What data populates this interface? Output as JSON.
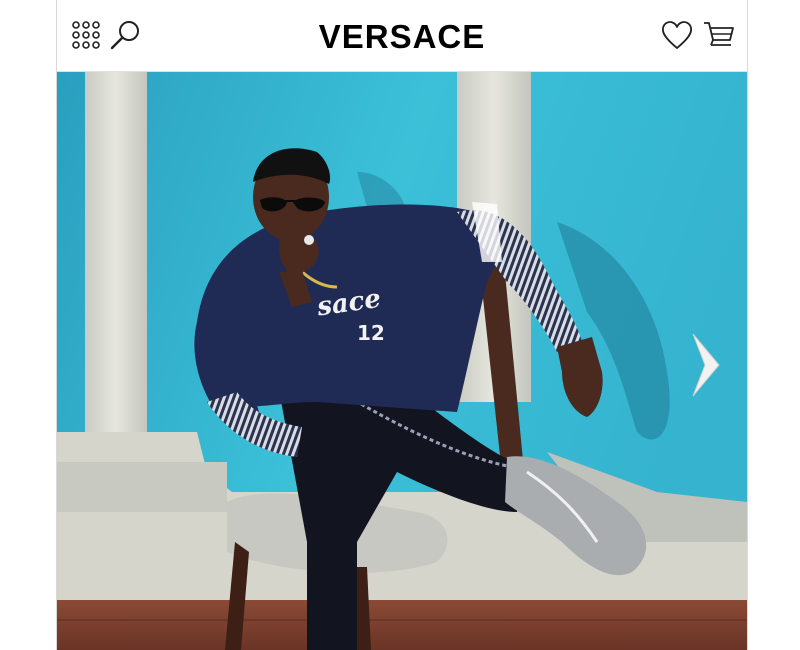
{
  "header": {
    "logo": "VERSACE",
    "menu_icon": "grid-menu-icon",
    "search_icon": "search-icon",
    "wishlist_icon": "heart-icon",
    "cart_icon": "cart-icon"
  },
  "hero": {
    "image": "model-seated-photo",
    "next_icon": "chevron-right-icon",
    "colors": {
      "background": "#34b8d2",
      "column": "#dcdcd2",
      "floor": "#7a3f2e",
      "jacket": "#1f2a55"
    }
  }
}
